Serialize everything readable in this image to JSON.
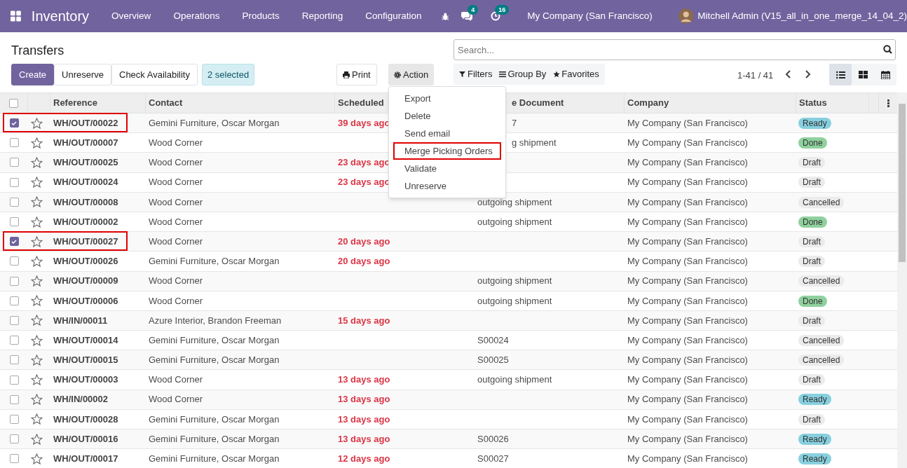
{
  "navbar": {
    "app_title": "Inventory",
    "menus": [
      "Overview",
      "Operations",
      "Products",
      "Reporting",
      "Configuration"
    ],
    "messages_count": "4",
    "activities_count": "16",
    "company": "My Company (San Francisco)",
    "user": "Mitchell Admin (V15_all_in_one_merge_14_04_2)"
  },
  "page_title": "Transfers",
  "buttons": [
    {
      "label": "Create",
      "kind": "primary"
    },
    {
      "label": "Unreserve",
      "kind": "secondary"
    },
    {
      "label": "Check Availability",
      "kind": "secondary"
    }
  ],
  "selection_badge": "2 selected",
  "print_button": "Print",
  "action_button": {
    "label": "Action",
    "expanded": true
  },
  "action_menu": [
    {
      "label": "Export",
      "highlighted": false
    },
    {
      "label": "Delete",
      "highlighted": false
    },
    {
      "label": "Send email",
      "highlighted": false
    },
    {
      "label": "Merge Picking Orders",
      "highlighted": true
    },
    {
      "label": "Validate",
      "highlighted": false
    },
    {
      "label": "Unreserve",
      "highlighted": false
    }
  ],
  "search": {
    "placeholder": "Search..."
  },
  "search_options": [
    "Filters",
    "Group By",
    "Favorites"
  ],
  "pager": "1-41 / 41",
  "views": [
    {
      "kind": "list",
      "selected": true
    },
    {
      "kind": "kanban",
      "selected": false
    },
    {
      "kind": "calendar",
      "selected": false
    }
  ],
  "table": {
    "all_selected": false,
    "columns": [
      "Reference",
      "Contact",
      "Scheduled",
      "e Document",
      "Company",
      "Status"
    ],
    "rows": [
      {
        "selected": true,
        "highlighted": true,
        "reference": "WH/OUT/00022",
        "contact": "Gemini Furniture, Oscar Morgan",
        "scheduled": "39 days ago",
        "source": "7",
        "company": "My Company (San Francisco)",
        "status": "Ready"
      },
      {
        "selected": false,
        "highlighted": false,
        "reference": "WH/OUT/00007",
        "contact": "Wood Corner",
        "scheduled": "",
        "source": "g shipment",
        "company": "My Company (San Francisco)",
        "status": "Done"
      },
      {
        "selected": false,
        "highlighted": false,
        "reference": "WH/OUT/00025",
        "contact": "Wood Corner",
        "scheduled": "23 days ago",
        "source": "",
        "company": "My Company (San Francisco)",
        "status": "Draft"
      },
      {
        "selected": false,
        "highlighted": false,
        "reference": "WH/OUT/00024",
        "contact": "Wood Corner",
        "scheduled": "23 days ago",
        "source": "",
        "company": "My Company (San Francisco)",
        "status": "Draft"
      },
      {
        "selected": false,
        "highlighted": false,
        "reference": "WH/OUT/00008",
        "contact": "Wood Corner",
        "scheduled": "",
        "source": "outgoing shipment",
        "company": "My Company (San Francisco)",
        "status": "Cancelled"
      },
      {
        "selected": false,
        "highlighted": false,
        "reference": "WH/OUT/00002",
        "contact": "Wood Corner",
        "scheduled": "",
        "source": "outgoing shipment",
        "company": "My Company (San Francisco)",
        "status": "Done"
      },
      {
        "selected": true,
        "highlighted": true,
        "reference": "WH/OUT/00027",
        "contact": "Wood Corner",
        "scheduled": "20 days ago",
        "source": "",
        "company": "My Company (San Francisco)",
        "status": "Draft"
      },
      {
        "selected": false,
        "highlighted": false,
        "reference": "WH/OUT/00026",
        "contact": "Gemini Furniture, Oscar Morgan",
        "scheduled": "20 days ago",
        "source": "",
        "company": "My Company (San Francisco)",
        "status": "Draft"
      },
      {
        "selected": false,
        "highlighted": false,
        "reference": "WH/OUT/00009",
        "contact": "Wood Corner",
        "scheduled": "",
        "source": "outgoing shipment",
        "company": "My Company (San Francisco)",
        "status": "Cancelled"
      },
      {
        "selected": false,
        "highlighted": false,
        "reference": "WH/OUT/00006",
        "contact": "Wood Corner",
        "scheduled": "",
        "source": "outgoing shipment",
        "company": "My Company (San Francisco)",
        "status": "Done"
      },
      {
        "selected": false,
        "highlighted": false,
        "reference": "WH/IN/00011",
        "contact": "Azure Interior, Brandon Freeman",
        "scheduled": "15 days ago",
        "source": "",
        "company": "My Company (San Francisco)",
        "status": "Draft"
      },
      {
        "selected": false,
        "highlighted": false,
        "reference": "WH/OUT/00014",
        "contact": "Gemini Furniture, Oscar Morgan",
        "scheduled": "",
        "source": "S00024",
        "company": "My Company (San Francisco)",
        "status": "Cancelled"
      },
      {
        "selected": false,
        "highlighted": false,
        "reference": "WH/OUT/00015",
        "contact": "Gemini Furniture, Oscar Morgan",
        "scheduled": "",
        "source": "S00025",
        "company": "My Company (San Francisco)",
        "status": "Cancelled"
      },
      {
        "selected": false,
        "highlighted": false,
        "reference": "WH/OUT/00003",
        "contact": "Wood Corner",
        "scheduled": "13 days ago",
        "source": "outgoing shipment",
        "company": "My Company (San Francisco)",
        "status": "Draft"
      },
      {
        "selected": false,
        "highlighted": false,
        "reference": "WH/IN/00002",
        "contact": "Wood Corner",
        "scheduled": "13 days ago",
        "source": "",
        "company": "My Company (San Francisco)",
        "status": "Ready"
      },
      {
        "selected": false,
        "highlighted": false,
        "reference": "WH/OUT/00028",
        "contact": "Gemini Furniture, Oscar Morgan",
        "scheduled": "13 days ago",
        "source": "",
        "company": "My Company (San Francisco)",
        "status": "Draft"
      },
      {
        "selected": false,
        "highlighted": false,
        "reference": "WH/OUT/00016",
        "contact": "Gemini Furniture, Oscar Morgan",
        "scheduled": "13 days ago",
        "source": "S00026",
        "company": "My Company (San Francisco)",
        "status": "Ready"
      },
      {
        "selected": false,
        "highlighted": false,
        "reference": "WH/OUT/00017",
        "contact": "Gemini Furniture, Oscar Morgan",
        "scheduled": "12 days ago",
        "source": "S00027",
        "company": "My Company (San Francisco)",
        "status": "Ready"
      }
    ]
  }
}
